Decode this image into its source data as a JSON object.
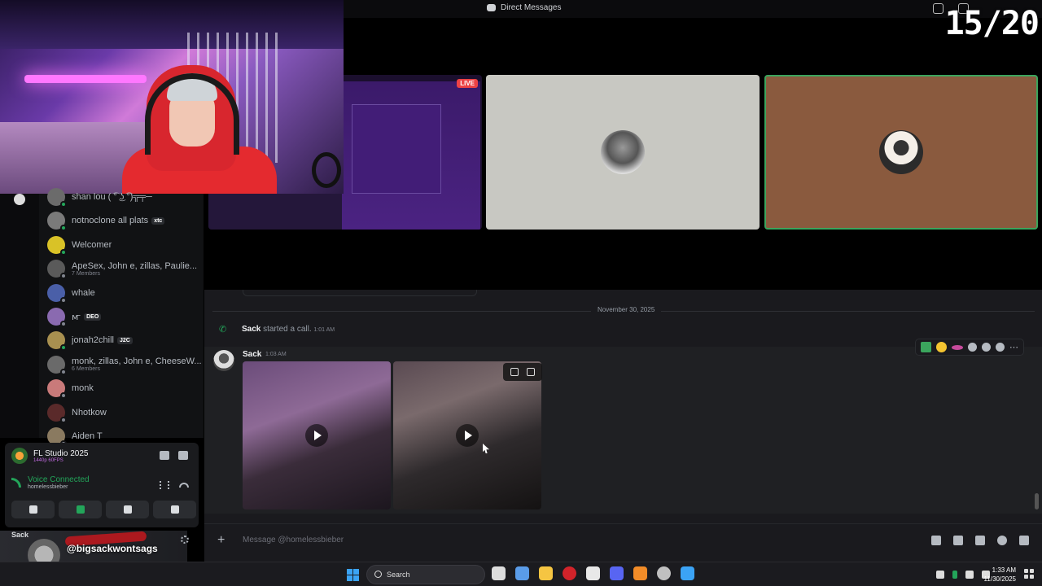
{
  "window": {
    "title": "Direct Messages"
  },
  "stream_counter": "15/20",
  "call": {
    "screen_share_badge": "LIVE",
    "speaking_border_color": "#3ba55d"
  },
  "dm_list": [
    {
      "name": "shan lou ( ͡° ͜ʖ ͡°)╦╤─",
      "sub": "",
      "tag": "",
      "online": true,
      "color": "#6b6b6b"
    },
    {
      "name": "notnoclone all plats",
      "sub": "",
      "tag": "xtc",
      "online": true,
      "color": "#7a7a7a"
    },
    {
      "name": "Welcomer",
      "sub": "",
      "tag": "",
      "online": true,
      "color": "#d9c227"
    },
    {
      "name": "ApeSex, John e, zillas, Paulie...",
      "sub": "7 Members",
      "tag": "",
      "online": false,
      "color": "#5a5a5a"
    },
    {
      "name": "whale",
      "sub": "",
      "tag": "",
      "online": false,
      "color": "#4a5fa8"
    },
    {
      "name": "ꙧ",
      "sub": "",
      "tag": "DEO",
      "online": false,
      "color": "#8a6ab0"
    },
    {
      "name": "jonah2chill",
      "sub": "",
      "tag": "J2C",
      "online": true,
      "color": "#a89050"
    },
    {
      "name": "monk, zillas, John e, CheeseW...",
      "sub": "6 Members",
      "tag": "",
      "online": false,
      "color": "#6a6a6a"
    },
    {
      "name": "monk",
      "sub": "",
      "tag": "",
      "online": false,
      "color": "#c97a7a"
    },
    {
      "name": "Nhotkow",
      "sub": "",
      "tag": "",
      "online": false,
      "color": "#5a2a2a"
    },
    {
      "name": "Aiden T",
      "sub": "",
      "tag": "",
      "online": false,
      "color": "#8a7a60"
    }
  ],
  "activity": {
    "app": "FL Studio 2025",
    "quality": "1440p 60FPS"
  },
  "voice": {
    "status": "Voice Connected",
    "channel": "homelessbieber"
  },
  "overlay": {
    "user": "Sack",
    "handle": "@bigsackwontsags"
  },
  "chat": {
    "date_divider": "November 30, 2025",
    "call_event": {
      "author": "Sack",
      "text": "started a call.",
      "time": "1:01 AM"
    },
    "message": {
      "author": "Sack",
      "time": "1:03 AM"
    },
    "composer_placeholder": "Message @homelessbieber"
  },
  "taskbar": {
    "search_label": "Search",
    "time": "1:33 AM",
    "date": "11/30/2025"
  }
}
